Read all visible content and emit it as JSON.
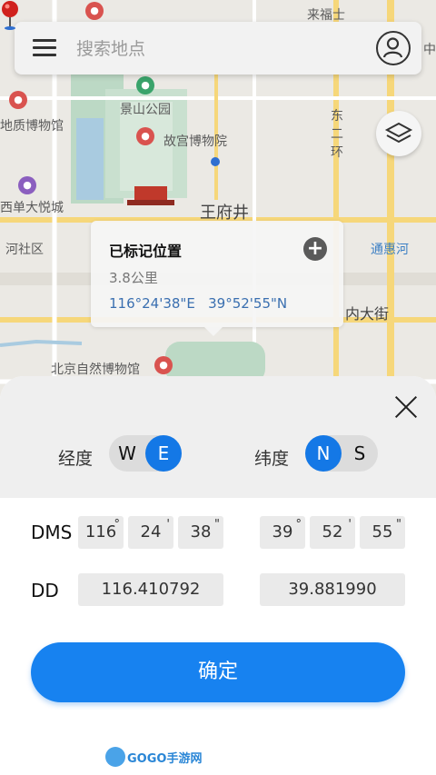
{
  "map": {
    "pois": [
      {
        "label": "来福士"
      },
      {
        "label": "景山公园"
      },
      {
        "label": "地质博物馆"
      },
      {
        "label": "故宫博物院"
      },
      {
        "label": "东二环"
      },
      {
        "label": "西单大悦城"
      },
      {
        "label": "王府井"
      },
      {
        "label": "河社区"
      },
      {
        "label": "通惠河"
      },
      {
        "label": "内大街"
      },
      {
        "label": "北京自然博物馆"
      },
      {
        "label": "中"
      }
    ]
  },
  "search": {
    "placeholder": "搜索地点"
  },
  "popup": {
    "title": "已标记位置",
    "distance": "3.8公里",
    "longitude": "116°24'38\"E",
    "latitude": "39°52'55\"N",
    "add_symbol": "+"
  },
  "sheet": {
    "longitude_label": "经度",
    "latitude_label": "纬度",
    "lon_toggle": {
      "options": [
        "W",
        "E"
      ],
      "selected": "E"
    },
    "lat_toggle": {
      "options": [
        "N",
        "S"
      ],
      "selected": "N"
    },
    "dms_label": "DMS",
    "dd_label": "DD",
    "lon_dms": [
      "116",
      "24",
      "38"
    ],
    "lat_dms": [
      "39",
      "52",
      "55"
    ],
    "dms_marks": [
      "°",
      "'",
      "\""
    ],
    "lon_dd": "116.410792",
    "lat_dd": "39.881990",
    "confirm_label": "确定"
  },
  "watermark": {
    "text": "GOGO手游网"
  },
  "colors": {
    "accent": "#1782f0",
    "map_road": "#f6d77a",
    "coords_blue": "#3a6fb0"
  },
  "icons": {
    "menu": "menu-icon",
    "avatar": "user-avatar-icon",
    "layers": "layers-icon",
    "close": "close-icon",
    "pin": "map-pin-icon",
    "add": "plus-icon"
  }
}
